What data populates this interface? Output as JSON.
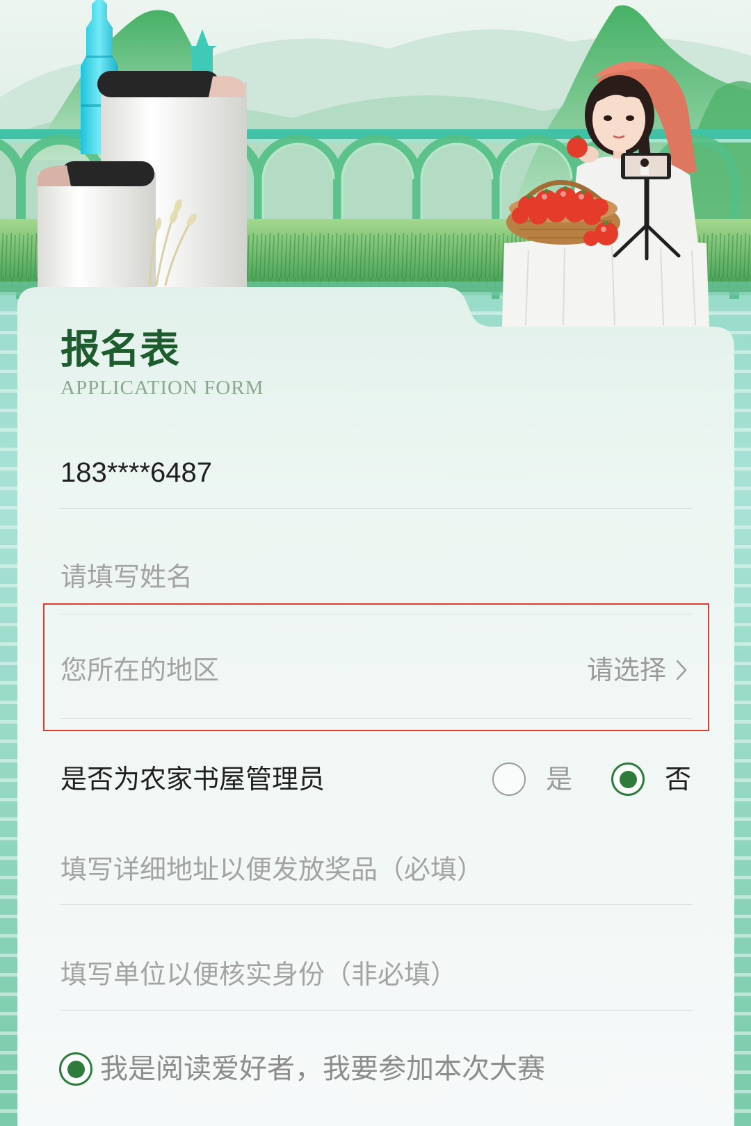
{
  "colors": {
    "title": "#1e5b2d",
    "subtitle": "#8aa890",
    "text": "#1f1f1f",
    "placeholder": "#a3a3a3",
    "divider": "#d8dedb",
    "radio_selected": "#2e7b3c",
    "radio_unselected": "#9c9c9c",
    "highlight_box": "#e23b2c"
  },
  "icons": {
    "region_arrow": "chevron-right-icon",
    "radio": "radio-icon"
  },
  "form": {
    "title": "报名表",
    "subtitle": "APPLICATION FORM",
    "phone": {
      "value": "183****6487"
    },
    "name": {
      "placeholder": "请填写姓名"
    },
    "region": {
      "label": "您所在的地区",
      "select_label": "请选择"
    },
    "librarian": {
      "question": "是否为农家书屋管理员",
      "options": [
        {
          "label": "是",
          "selected": false
        },
        {
          "label": "否",
          "selected": true
        }
      ]
    },
    "address": {
      "placeholder": "填写详细地址以便发放奖品（必填）"
    },
    "organization": {
      "placeholder": "填写单位以便核实身份（非必填）"
    },
    "agreement": {
      "label": "我是阅读爱好者，我要参加本次大赛",
      "checked": true
    }
  }
}
